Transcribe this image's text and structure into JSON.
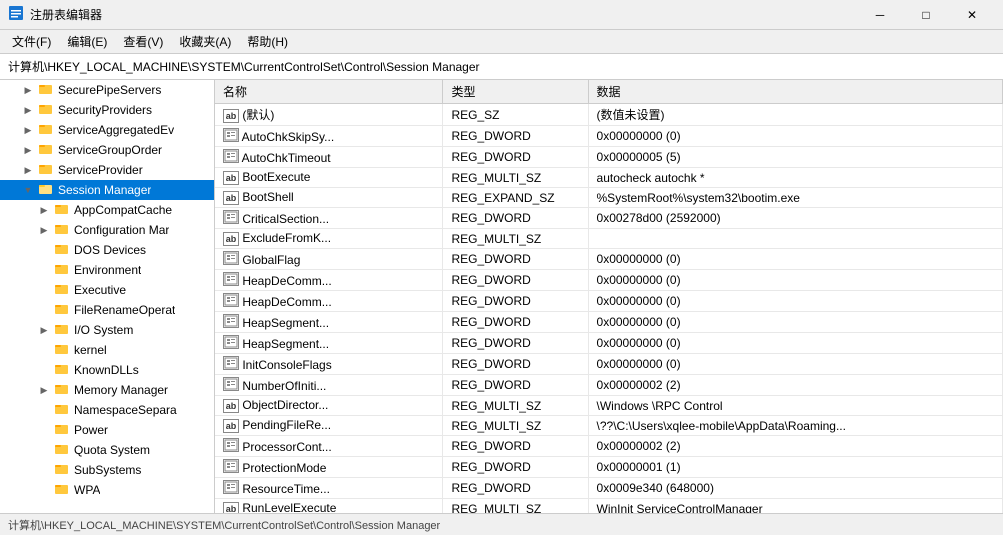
{
  "window": {
    "title": "注册表编辑器",
    "controls": {
      "minimize": "─",
      "maximize": "□",
      "close": "✕"
    }
  },
  "menu": {
    "items": [
      "文件(F)",
      "编辑(E)",
      "查看(V)",
      "收藏夹(A)",
      "帮助(H)"
    ]
  },
  "address": {
    "label": "计算机\\HKEY_LOCAL_MACHINE\\SYSTEM\\CurrentControlSet\\Control\\Session Manager"
  },
  "tree": {
    "items": [
      {
        "id": "securepipeservers",
        "label": "SecurePipeServers",
        "indent": 1,
        "expanded": false,
        "selected": false
      },
      {
        "id": "securityproviders",
        "label": "SecurityProviders",
        "indent": 1,
        "expanded": false,
        "selected": false
      },
      {
        "id": "serviceaggregatedev",
        "label": "ServiceAggregatedEv",
        "indent": 1,
        "expanded": false,
        "selected": false
      },
      {
        "id": "servicegrouporder",
        "label": "ServiceGroupOrder",
        "indent": 1,
        "expanded": false,
        "selected": false
      },
      {
        "id": "serviceprovider",
        "label": "ServiceProvider",
        "indent": 1,
        "expanded": false,
        "selected": false
      },
      {
        "id": "sessionmanager",
        "label": "Session Manager",
        "indent": 1,
        "expanded": true,
        "selected": true
      },
      {
        "id": "appcompatcache",
        "label": "AppCompatCache",
        "indent": 2,
        "expanded": false,
        "selected": false
      },
      {
        "id": "configurationmar",
        "label": "Configuration Mar",
        "indent": 2,
        "expanded": false,
        "selected": false
      },
      {
        "id": "dosdevices",
        "label": "DOS Devices",
        "indent": 2,
        "expanded": false,
        "selected": false
      },
      {
        "id": "environment",
        "label": "Environment",
        "indent": 2,
        "expanded": false,
        "selected": false
      },
      {
        "id": "executive",
        "label": "Executive",
        "indent": 2,
        "expanded": false,
        "selected": false
      },
      {
        "id": "filerenameOperat",
        "label": "FileRenameOperat",
        "indent": 2,
        "expanded": false,
        "selected": false
      },
      {
        "id": "iosystem",
        "label": "I/O System",
        "indent": 2,
        "expanded": false,
        "selected": false
      },
      {
        "id": "kernel",
        "label": "kernel",
        "indent": 2,
        "expanded": false,
        "selected": false
      },
      {
        "id": "knowndlls",
        "label": "KnownDLLs",
        "indent": 2,
        "expanded": false,
        "selected": false
      },
      {
        "id": "memorymanager",
        "label": "Memory Manager",
        "indent": 2,
        "expanded": false,
        "selected": false
      },
      {
        "id": "namespaceSepara",
        "label": "NamespaceSepara",
        "indent": 2,
        "expanded": false,
        "selected": false
      },
      {
        "id": "power",
        "label": "Power",
        "indent": 2,
        "expanded": false,
        "selected": false
      },
      {
        "id": "quotasystem",
        "label": "Quota System",
        "indent": 2,
        "expanded": false,
        "selected": false
      },
      {
        "id": "subsystems",
        "label": "SubSystems",
        "indent": 2,
        "expanded": false,
        "selected": false
      },
      {
        "id": "wpa",
        "label": "WPA",
        "indent": 2,
        "expanded": false,
        "selected": false
      }
    ]
  },
  "table": {
    "headers": [
      "名称",
      "类型",
      "数据"
    ],
    "rows": [
      {
        "name": "(默认)",
        "type": "REG_SZ",
        "data": "(数值未设置)",
        "icon": "ab"
      },
      {
        "name": "AutoChkSkipSy...",
        "type": "REG_DWORD",
        "data": "0x00000000 (0)",
        "icon": "reg"
      },
      {
        "name": "AutoChkTimeout",
        "type": "REG_DWORD",
        "data": "0x00000005 (5)",
        "icon": "reg"
      },
      {
        "name": "BootExecute",
        "type": "REG_MULTI_SZ",
        "data": "autocheck autochk *",
        "icon": "ab"
      },
      {
        "name": "BootShell",
        "type": "REG_EXPAND_SZ",
        "data": "%SystemRoot%\\system32\\bootim.exe",
        "icon": "ab"
      },
      {
        "name": "CriticalSection...",
        "type": "REG_DWORD",
        "data": "0x00278d00 (2592000)",
        "icon": "reg"
      },
      {
        "name": "ExcludeFromK...",
        "type": "REG_MULTI_SZ",
        "data": "",
        "icon": "ab"
      },
      {
        "name": "GlobalFlag",
        "type": "REG_DWORD",
        "data": "0x00000000 (0)",
        "icon": "reg"
      },
      {
        "name": "HeapDeComm...",
        "type": "REG_DWORD",
        "data": "0x00000000 (0)",
        "icon": "reg"
      },
      {
        "name": "HeapDeComm...",
        "type": "REG_DWORD",
        "data": "0x00000000 (0)",
        "icon": "reg"
      },
      {
        "name": "HeapSegment...",
        "type": "REG_DWORD",
        "data": "0x00000000 (0)",
        "icon": "reg"
      },
      {
        "name": "HeapSegment...",
        "type": "REG_DWORD",
        "data": "0x00000000 (0)",
        "icon": "reg"
      },
      {
        "name": "InitConsoleFlags",
        "type": "REG_DWORD",
        "data": "0x00000000 (0)",
        "icon": "reg"
      },
      {
        "name": "NumberOfIniti...",
        "type": "REG_DWORD",
        "data": "0x00000002 (2)",
        "icon": "reg"
      },
      {
        "name": "ObjectDirector...",
        "type": "REG_MULTI_SZ",
        "data": "\\Windows \\RPC Control",
        "icon": "ab"
      },
      {
        "name": "PendingFileRe...",
        "type": "REG_MULTI_SZ",
        "data": "\\??\\C:\\Users\\xqlee-mobile\\AppData\\Roaming...",
        "icon": "ab"
      },
      {
        "name": "ProcessorCont...",
        "type": "REG_DWORD",
        "data": "0x00000002 (2)",
        "icon": "reg"
      },
      {
        "name": "ProtectionMode",
        "type": "REG_DWORD",
        "data": "0x00000001 (1)",
        "icon": "reg"
      },
      {
        "name": "ResourceTime...",
        "type": "REG_DWORD",
        "data": "0x0009e340 (648000)",
        "icon": "reg"
      },
      {
        "name": "RunLevelExecute",
        "type": "REG_MULTI_SZ",
        "data": "WinInit ServiceControlManager",
        "icon": "ab"
      }
    ]
  },
  "statusbar": {
    "text": "计算机\\HKEY_LOCAL_MACHINE\\SYSTEM\\CurrentControlSet\\Control\\Session Manager"
  }
}
